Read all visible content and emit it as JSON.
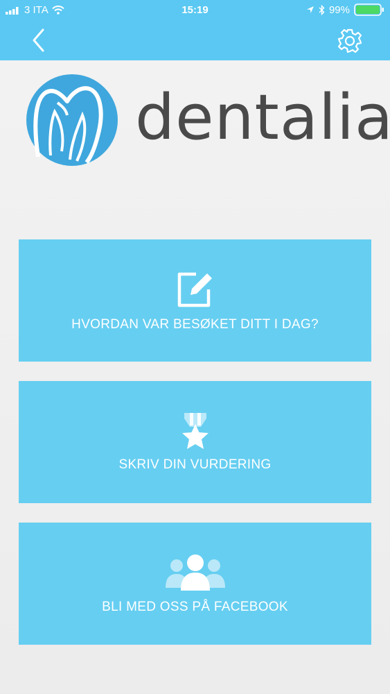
{
  "status_bar": {
    "carrier": "3 ITA",
    "time": "15:19",
    "battery_percent": "99%"
  },
  "header": {
    "back_icon": "chevron-left-icon",
    "settings_icon": "gear-icon",
    "accent_color": "#5ac8f2"
  },
  "brand": {
    "name": "dentalia",
    "logo_color": "#3fa7dd"
  },
  "menu": {
    "tile_color": "#66cef1",
    "items": [
      {
        "label": "HVORDAN VAR BESØKET DITT I DAG?",
        "icon": "edit-icon"
      },
      {
        "label": "SKRIV DIN VURDERING",
        "icon": "medal-star-icon"
      },
      {
        "label": "BLI MED OSS PÅ FACEBOOK",
        "icon": "users-icon"
      }
    ]
  }
}
